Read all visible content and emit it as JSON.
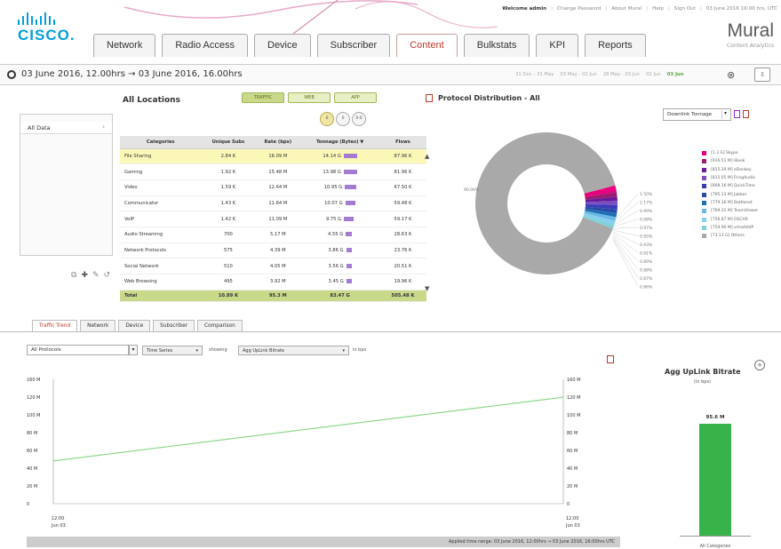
{
  "header": {
    "logo_text": "CISCO.",
    "welcome": "Welcome admin",
    "links": [
      "Change Password",
      "About Mural",
      "Help",
      "Sign Out"
    ],
    "datetime": "03 June 2016 16:00 hrs, UTC",
    "brand": "Mural",
    "brand_sub": "Content Analytics",
    "tabs": [
      "Network",
      "Radio Access",
      "Device",
      "Subscriber",
      "Content",
      "Bulkstats",
      "KPI",
      "Reports"
    ],
    "active_tab": "Content"
  },
  "datebar": {
    "range": "03 June 2016, 12.00hrs → 03 June 2016, 16.00hrs",
    "quick": [
      "31 Dec - 31 May",
      "03 May - 02 Jun",
      "28 May - 03 Jun",
      "02 Jun",
      "03 Jun"
    ]
  },
  "left_panel": {
    "item": "All Data"
  },
  "table_section": {
    "title": "All Locations",
    "toggle": [
      "TRAFFIC",
      "WEB",
      "APP"
    ],
    "circles": [
      "0",
      "0",
      "0-0"
    ],
    "columns": [
      "Categories",
      "Unique Subs",
      "Rate (bps)",
      "Tonnage (Bytes)",
      "Flows"
    ],
    "rows": [
      [
        "File Sharing",
        "2.84 K",
        "16.09 M",
        "14.14 G",
        "87.96 K"
      ],
      [
        "Gaming",
        "1.92 K",
        "15.48 M",
        "13.98 G",
        "81.96 K"
      ],
      [
        "Video",
        "1.59 K",
        "12.64 M",
        "10.95 G",
        "67.50 K"
      ],
      [
        "Communicator",
        "1.43 K",
        "11.64 M",
        "10.07 G",
        "59.48 K"
      ],
      [
        "VoIP",
        "1.42 K",
        "11.09 M",
        "9.75 G",
        "59.17 K"
      ],
      [
        "Audio Streaming",
        "700",
        "5.17 M",
        "4.55 G",
        "28.63 K"
      ],
      [
        "Network Protocols",
        "575",
        "4.39 M",
        "3.86 G",
        "23.76 K"
      ],
      [
        "Social Network",
        "510",
        "4.05 M",
        "3.56 G",
        "20.51 K"
      ],
      [
        "Web Browsing",
        "495",
        "3.92 M",
        "3.45 G",
        "19.96 K"
      ]
    ],
    "total": [
      "Total",
      "10.89 K",
      "95.3 M",
      "83.47 G",
      "505.48 K"
    ]
  },
  "distribution": {
    "title": "Protocol Distribution - All",
    "dropdown": "Downlink Tonnage",
    "main_label": "90.00%",
    "slice_labels": [
      "1.50%",
      "1.17%",
      "0.99%",
      "0.98%",
      "0.97%",
      "0.95%",
      "0.93%",
      "0.91%",
      "0.89%",
      "0.88%",
      "0.87%",
      "0.86%"
    ],
    "legend": [
      {
        "label": "[1.3 G] Skype",
        "color": "#e6007e"
      },
      {
        "label": "[916.51 M] iBook",
        "color": "#9b1c6e"
      },
      {
        "label": "[815.29 M] eDonkey",
        "color": "#6a1b9a"
      },
      {
        "label": "[815.05 M] FringAudio",
        "color": "#7b4fc2"
      },
      {
        "label": "[808.16 M] QuickTime",
        "color": "#3a3ab8"
      },
      {
        "label": "[795.13 M] Jabber",
        "color": "#2a4ca8"
      },
      {
        "label": "[779.16 M] Battlenet",
        "color": "#1f6fb2"
      },
      {
        "label": "[769.31 M] TeamViewer",
        "color": "#6ab7e6"
      },
      {
        "label": "[756.87 M] OSCAR",
        "color": "#87cfee"
      },
      {
        "label": "[754.90 M] vchatVoIP",
        "color": "#7fd3d8"
      },
      {
        "label": "[73.13 G] Others",
        "color": "#a9a9a9"
      }
    ],
    "slices": [
      {
        "color": "#a9a9a9",
        "value": 90.0
      },
      {
        "color": "#e6007e",
        "value": 1.5
      },
      {
        "color": "#9b1c6e",
        "value": 1.05
      },
      {
        "color": "#6a1b9a",
        "value": 0.95
      },
      {
        "color": "#7b4fc2",
        "value": 0.93
      },
      {
        "color": "#3a3ab8",
        "value": 0.92
      },
      {
        "color": "#2a4ca8",
        "value": 0.91
      },
      {
        "color": "#1f6fb2",
        "value": 0.9
      },
      {
        "color": "#6ab7e6",
        "value": 0.89
      },
      {
        "color": "#87cfee",
        "value": 0.88
      },
      {
        "color": "#7fd3d8",
        "value": 0.87
      }
    ]
  },
  "bottom_tabs": [
    "Traffic Trend",
    "Network",
    "Device",
    "Subscriber",
    "Comparison"
  ],
  "trend": {
    "protocol": "All Protocols",
    "mode": "Time Series",
    "showing": "showing",
    "metric": "Agg UpLink Bitrate",
    "unit": "in bps",
    "y_ticks": [
      "160 M",
      "120 M",
      "100 M",
      "80 M",
      "60 M",
      "40 M",
      "20 M",
      "0"
    ],
    "x_start": [
      "12:00",
      "Jun 03"
    ],
    "x_end": [
      "12:00",
      "Jun 03"
    ],
    "footer": "Applied time range: 03 June 2016, 12:00hrs → 03 June 2016, 16:00hrs UTC",
    "series": {
      "start": 55,
      "end": 137,
      "color": "#8fd98f"
    }
  },
  "agg": {
    "title": "Agg UpLink Bitrate",
    "unit": "(in bps)",
    "value": "95.6 M",
    "category": "All Categories",
    "bar_fraction": 0.82
  }
}
